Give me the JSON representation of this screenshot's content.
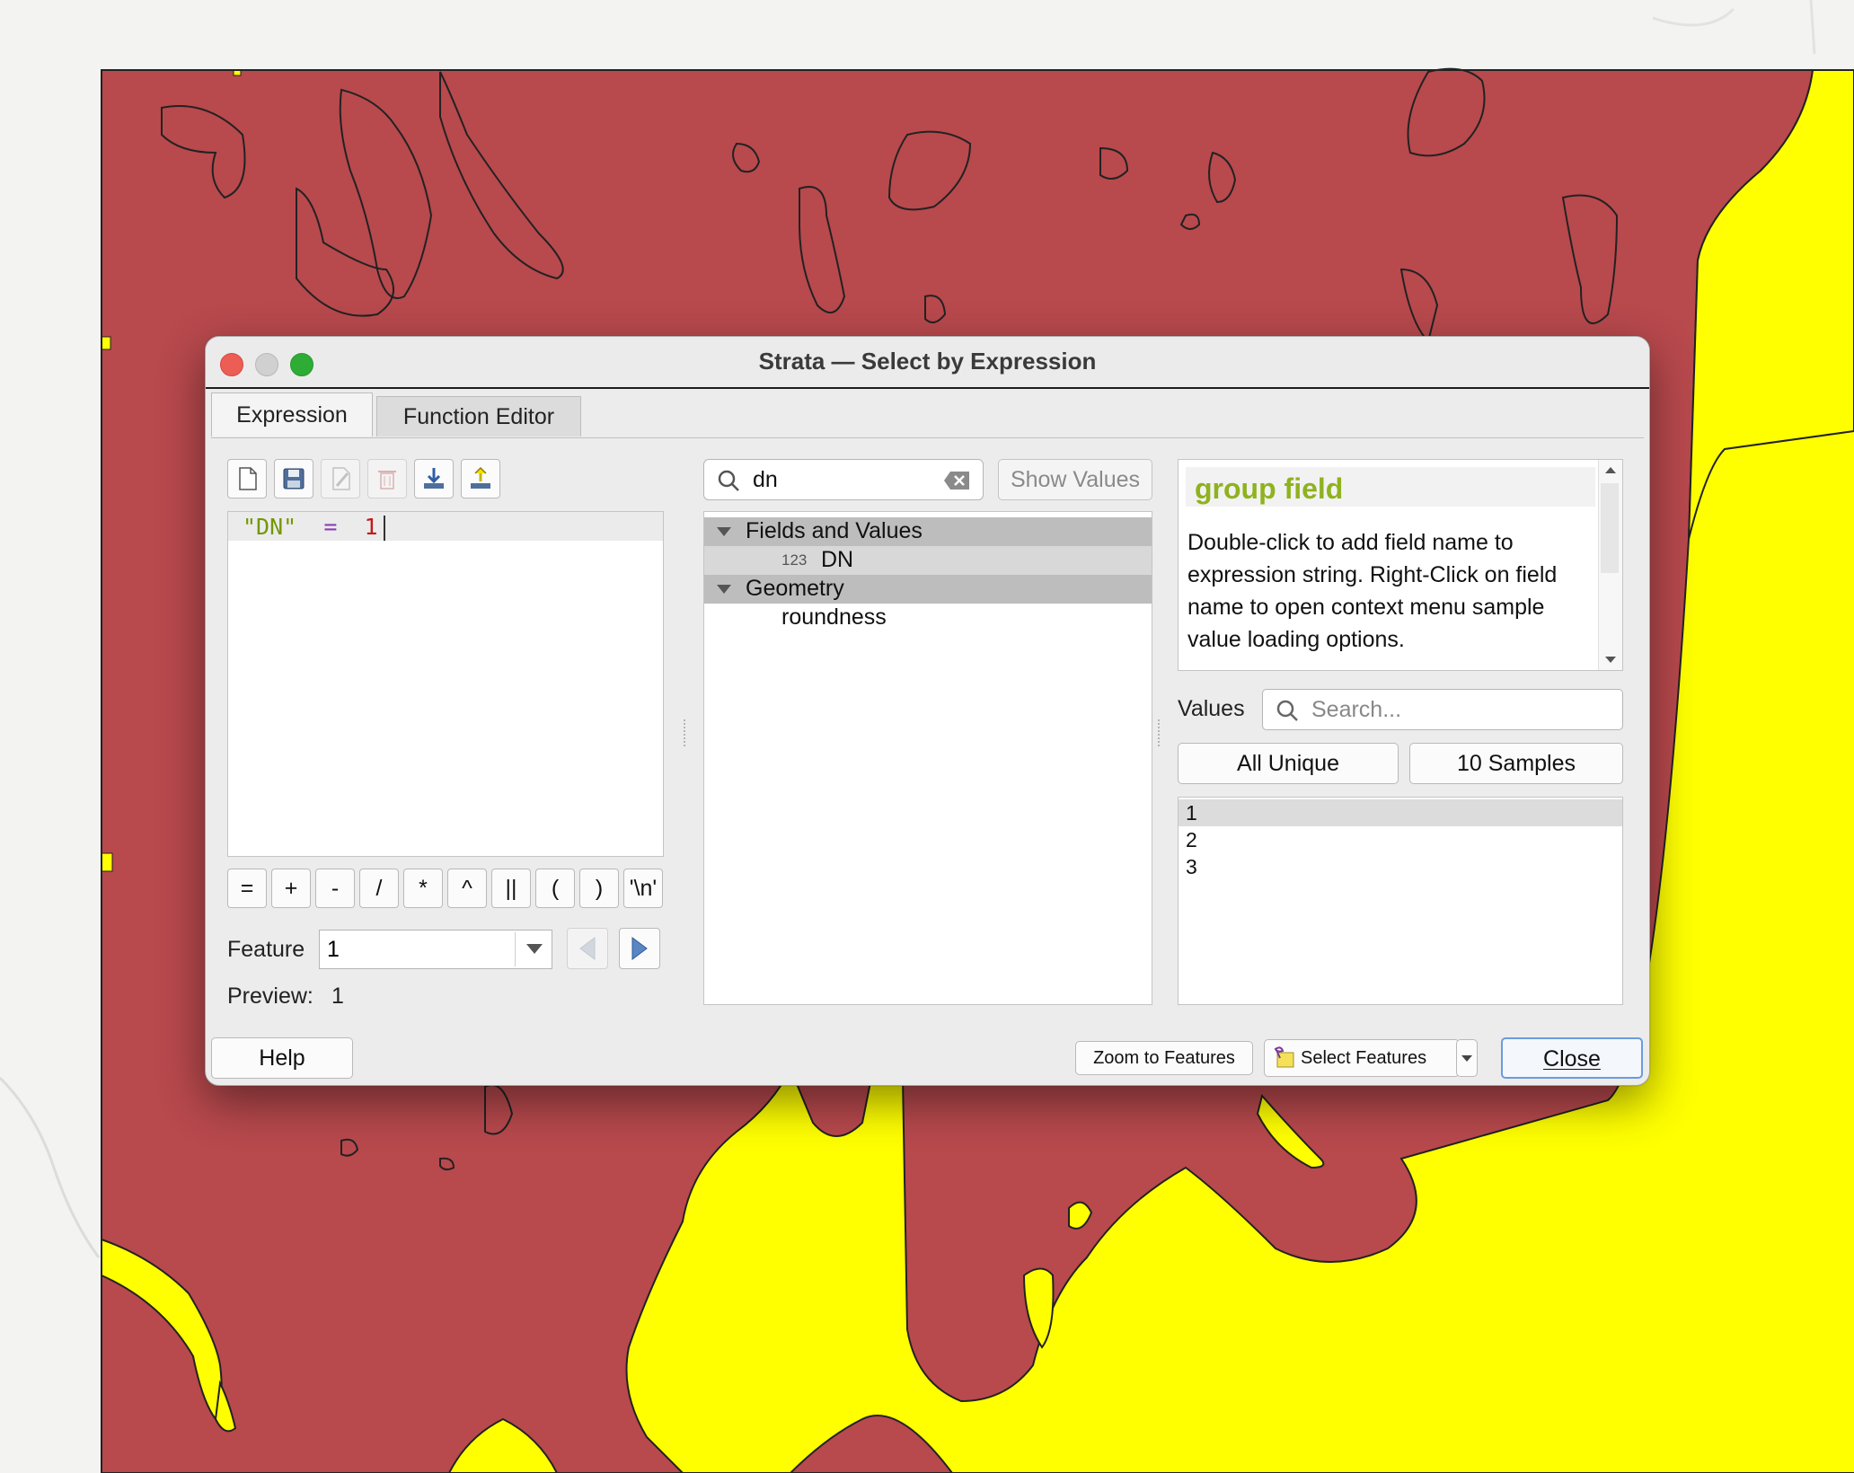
{
  "window": {
    "title": "Strata — Select by Expression"
  },
  "tabs": [
    {
      "label": "Expression"
    },
    {
      "label": "Function Editor"
    }
  ],
  "toolbar": {
    "icons": [
      "new-file-icon",
      "save-icon",
      "edit-icon",
      "delete-icon",
      "import-icon",
      "export-icon"
    ]
  },
  "expression": {
    "field": "\"DN\"",
    "operator": "=",
    "value": "1"
  },
  "operators": [
    "=",
    "+",
    "-",
    "/",
    "*",
    "^",
    "||",
    "(",
    ")",
    "'\\n'"
  ],
  "feature": {
    "label": "Feature",
    "value": "1"
  },
  "preview": {
    "label": "Preview:",
    "value": "1"
  },
  "search": {
    "value": "dn",
    "show_values_label": "Show Values"
  },
  "tree": {
    "groups": [
      {
        "label": "Fields and Values",
        "items": [
          {
            "type_badge": "123",
            "label": "DN"
          }
        ]
      },
      {
        "label": "Geometry",
        "items": [
          {
            "label": "roundness"
          }
        ]
      }
    ]
  },
  "help": {
    "title": "group field",
    "body": "Double-click to add field name to expression string. Right-Click on field name to open context menu sample value loading options."
  },
  "values": {
    "label": "Values",
    "search_placeholder": "Search...",
    "all_unique_label": "All Unique",
    "samples_label": "10 Samples",
    "items": [
      "1",
      "2",
      "3"
    ]
  },
  "footer": {
    "help_label": "Help",
    "zoom_label": "Zoom to Features",
    "select_label": "Select Features",
    "close_label": "Close"
  },
  "colors": {
    "polygon_red": "#b8494d",
    "polygon_yellow": "#ffff00",
    "help_title": "#8fb21e"
  }
}
